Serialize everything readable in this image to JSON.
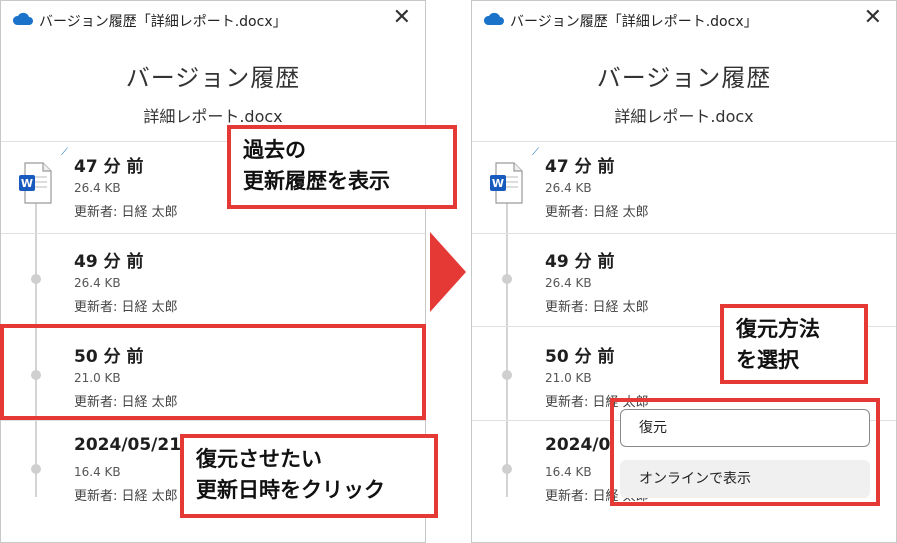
{
  "colors": {
    "accent_red": "#e53935",
    "onedrive_blue": "#1a73c9",
    "word_blue": "#185abd"
  },
  "left": {
    "window_title": "バージョン履歴「詳細レポート.docx」",
    "heading": "バージョン履歴",
    "filename": "詳細レポート.docx",
    "entries": [
      {
        "time": "47 分 前",
        "size": "26.4 KB",
        "updated_by": "更新者: 日経 太郎"
      },
      {
        "time": "49 分 前",
        "size": "26.4 KB",
        "updated_by": "更新者: 日経 太郎"
      },
      {
        "time": "50 分 前",
        "size": "21.0 KB",
        "updated_by": "更新者: 日経 太郎"
      },
      {
        "time": "2024/05/21 (",
        "size": "16.4 KB",
        "updated_by": "更新者: 日経 太郎"
      }
    ],
    "callout_history": [
      "過去の",
      "更新履歴を表示"
    ],
    "callout_click": [
      "復元させたい",
      "更新日時をクリック"
    ]
  },
  "right": {
    "window_title": "バージョン履歴「詳細レポート.docx」",
    "heading": "バージョン履歴",
    "filename": "詳細レポート.docx",
    "entries": [
      {
        "time": "47 分 前",
        "size": "26.4 KB",
        "updated_by": "更新者: 日経 太郎"
      },
      {
        "time": "49 分 前",
        "size": "26.4 KB",
        "updated_by": "更新者: 日経 太郎"
      },
      {
        "time": "50 分 前",
        "size": "21.0 KB",
        "updated_by": "更新者: 日経 太郎"
      },
      {
        "time": "2024/0",
        "size": "16.4 KB",
        "updated_by": "更新者: 日経 太郎"
      }
    ],
    "callout_method": [
      "復元方法",
      "を選択"
    ],
    "menu": {
      "restore_label": "復元",
      "online_label": "オンラインで表示"
    }
  },
  "icons": {
    "cloud": "onedrive-cloud-icon",
    "close": "close-icon",
    "word": "word-document-icon",
    "arrow": "arrow-right-icon"
  }
}
